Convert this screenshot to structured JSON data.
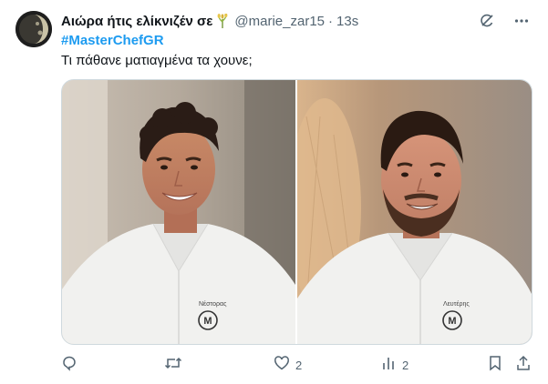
{
  "tweet": {
    "author_name": "Αιώρα ήτις ελίκνιζέν σε",
    "author_emoji_icon": "sheaf-of-rice-icon",
    "handle": "@marie_zar15",
    "separator": "·",
    "time": "13s",
    "hashtag": "#MasterChefGR",
    "text": "Τι πάθανε ματιαγμένα τα χουνε;",
    "media": [
      {
        "description_icon": "contestant-photo-left",
        "apron_name": "Νέστορας",
        "apron_logo": "MasterChef"
      },
      {
        "description_icon": "contestant-photo-right",
        "apron_name": "Λευτέρης",
        "apron_logo": "MasterChef"
      }
    ]
  },
  "header_actions": {
    "grok_icon": "grok-icon",
    "more_icon": "more-dots-icon"
  },
  "actions": {
    "reply": {
      "icon": "reply-icon",
      "count": ""
    },
    "retweet": {
      "icon": "retweet-icon",
      "count": ""
    },
    "like": {
      "icon": "heart-icon",
      "count": "2"
    },
    "views": {
      "icon": "views-bar-chart-icon",
      "count": "2"
    },
    "bookmark": {
      "icon": "bookmark-icon",
      "count": ""
    },
    "share": {
      "icon": "share-icon",
      "count": ""
    }
  },
  "colors": {
    "text_primary": "#0f1419",
    "text_secondary": "#536471",
    "link_blue": "#1d9bf0"
  }
}
